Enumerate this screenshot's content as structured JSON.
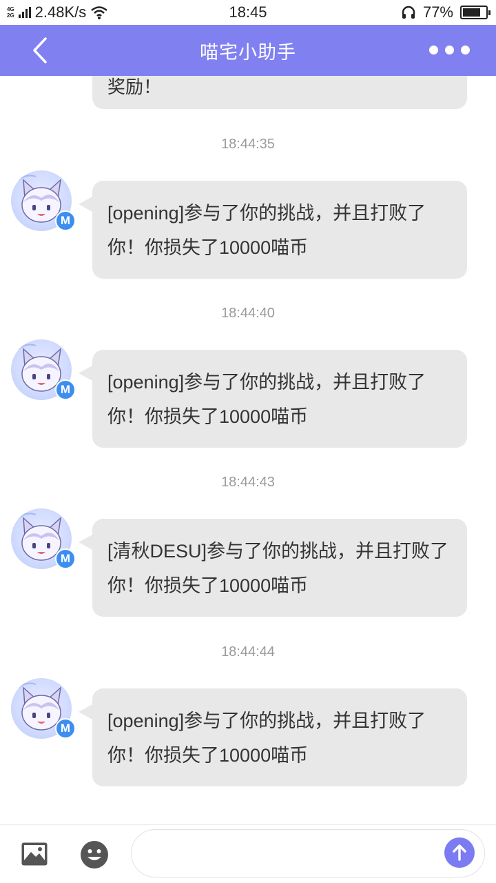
{
  "status_bar": {
    "network_type_top": "4G",
    "network_type_bottom": "2G",
    "speed": "2.48K/s",
    "time": "18:45",
    "battery": "77%",
    "battery_level": 0.77
  },
  "header": {
    "title": "喵宅小助手"
  },
  "chat": {
    "previous_message_tail": "奖励！",
    "messages": [
      {
        "time": "18:44:35",
        "badge": "M",
        "text": "[opening]参与了你的挑战，并且打败了你！你损失了10000喵币"
      },
      {
        "time": "18:44:40",
        "badge": "M",
        "text": "[opening]参与了你的挑战，并且打败了你！你损失了10000喵币"
      },
      {
        "time": "18:44:43",
        "badge": "M",
        "text": "[清秋DESU]参与了你的挑战，并且打败了你！你损失了10000喵币"
      },
      {
        "time": "18:44:44",
        "badge": "M",
        "text": "[opening]参与了你的挑战，并且打败了你！你损失了10000喵币"
      }
    ]
  },
  "input_bar": {
    "placeholder": "",
    "value": ""
  },
  "colors": {
    "nav_bar": "#8080f0",
    "bubble": "#e8e8e8",
    "badge": "#3c8ef0",
    "send_button": "#7c7cf2"
  }
}
